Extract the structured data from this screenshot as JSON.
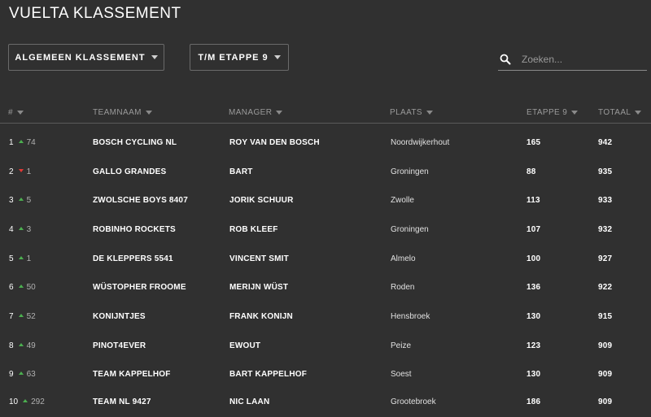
{
  "page": {
    "title": "VUELTA KLASSEMENT"
  },
  "filters": {
    "ranking_label": "ALGEMEEN KLASSEMENT",
    "stage_label": "T/M ETAPPE 9"
  },
  "search": {
    "placeholder": "Zoeken...",
    "icon": "search-icon"
  },
  "table": {
    "headers": [
      "#",
      "TEAMNAAM",
      "MANAGER",
      "PLAATS",
      "ETAPPE 9",
      "TOTAAL"
    ],
    "rows": [
      {
        "pos": "1",
        "trend": "up",
        "change": "74",
        "team": "BOSCH CYCLING NL",
        "manager": "ROY VAN DEN BOSCH",
        "place": "Noordwijkerhout",
        "stage": "165",
        "total": "942"
      },
      {
        "pos": "2",
        "trend": "down",
        "change": "1",
        "team": "GALLO GRANDES",
        "manager": "BART",
        "place": "Groningen",
        "stage": "88",
        "total": "935"
      },
      {
        "pos": "3",
        "trend": "up",
        "change": "5",
        "team": "ZWOLSCHE BOYS 8407",
        "manager": "JORIK SCHUUR",
        "place": "Zwolle",
        "stage": "113",
        "total": "933"
      },
      {
        "pos": "4",
        "trend": "up",
        "change": "3",
        "team": "ROBINHO ROCKETS",
        "manager": "ROB KLEEF",
        "place": "Groningen",
        "stage": "107",
        "total": "932"
      },
      {
        "pos": "5",
        "trend": "up",
        "change": "1",
        "team": "DE KLEPPERS 5541",
        "manager": "VINCENT SMIT",
        "place": "Almelo",
        "stage": "100",
        "total": "927"
      },
      {
        "pos": "6",
        "trend": "up",
        "change": "50",
        "team": "WÜSTOPHER FROOME",
        "manager": "MERIJN WÜST",
        "place": "Roden",
        "stage": "136",
        "total": "922"
      },
      {
        "pos": "7",
        "trend": "up",
        "change": "52",
        "team": "KONIJNTJES",
        "manager": "FRANK KONIJN",
        "place": "Hensbroek",
        "stage": "130",
        "total": "915"
      },
      {
        "pos": "8",
        "trend": "up",
        "change": "49",
        "team": "PINOT4EVER",
        "manager": "EWOUT",
        "place": "Peize",
        "stage": "123",
        "total": "909"
      },
      {
        "pos": "9",
        "trend": "up",
        "change": "63",
        "team": "TEAM KAPPELHOF",
        "manager": "BART KAPPELHOF",
        "place": "Soest",
        "stage": "130",
        "total": "909"
      },
      {
        "pos": "10",
        "trend": "up",
        "change": "292",
        "team": "TEAM NL 9427",
        "manager": "NIC LAAN",
        "place": "Grootebroek",
        "stage": "186",
        "total": "909"
      }
    ]
  },
  "colors": {
    "background": "#303030",
    "trend_up": "#4caf50",
    "trend_down": "#e53935"
  }
}
